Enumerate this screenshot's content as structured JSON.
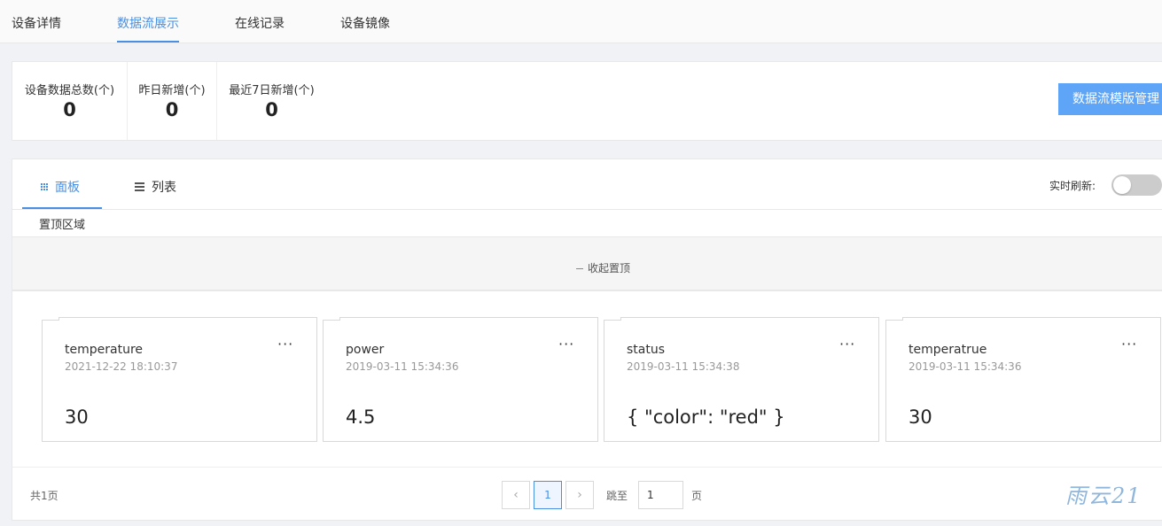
{
  "top_tabs": [
    "设备详情",
    "数据流展示",
    "在线记录",
    "设备镜像"
  ],
  "active_top_tab": "数据流展示",
  "stats": [
    {
      "label": "设备数据总数(个)",
      "value": "0"
    },
    {
      "label": "昨日新增(个)",
      "value": "0"
    },
    {
      "label": "最近7日新增(个)",
      "value": "0"
    }
  ],
  "template_button": "数据流模版管理",
  "view_tabs": {
    "panel": "面板",
    "list": "列表"
  },
  "realtime_refresh": {
    "label": "实时刷新:",
    "enabled": false
  },
  "pin_area_label": "置顶区域",
  "collapse_pin": "收起置顶",
  "cards": [
    {
      "name": "temperature",
      "time": "2021-12-22 18:10:37",
      "value": "30"
    },
    {
      "name": "power",
      "time": "2019-03-11 15:34:36",
      "value": "4.5"
    },
    {
      "name": "status",
      "time": "2019-03-11 15:34:38",
      "value": "{ \"color\": \"red\" }"
    },
    {
      "name": "temperatrue",
      "time": "2019-03-11 15:34:36",
      "value": "30"
    }
  ],
  "card_more": "···",
  "pagination": {
    "total": "共1页",
    "prev": "‹",
    "current": "1",
    "next": "›",
    "jump_label": "跳至",
    "jump_value": "1",
    "unit": "页"
  },
  "watermark": "雨云21",
  "colors": {
    "accent": "#4a90e2",
    "button": "#5ea4f7"
  }
}
